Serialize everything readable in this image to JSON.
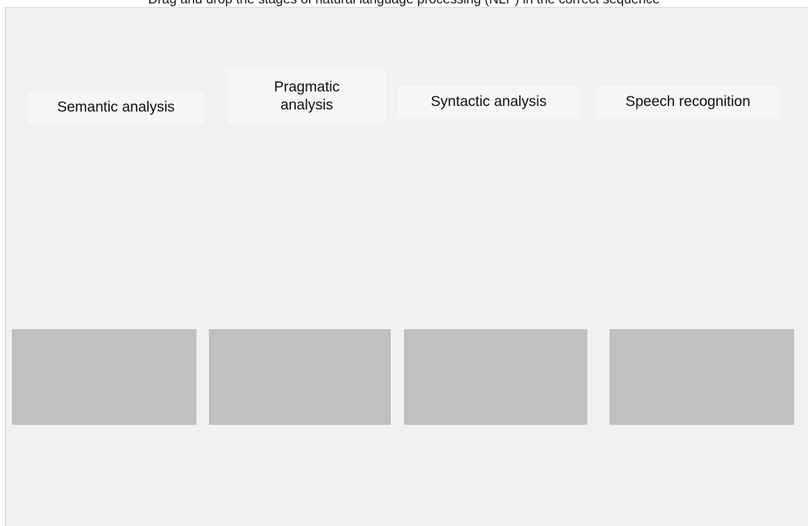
{
  "caption": {
    "text": "Drag and drop the stages of natural language processing (NLP) in the correct sequence"
  },
  "cards": [
    {
      "label": "Semantic analysis"
    },
    {
      "label": "Pragmatic analysis"
    },
    {
      "label": "Syntactic analysis"
    },
    {
      "label": "Speech recognition"
    }
  ],
  "colors": {
    "panel_background": "#f1f1f1",
    "card_background": "#f6f6f6",
    "drop_slot": "#c0c0c0"
  }
}
